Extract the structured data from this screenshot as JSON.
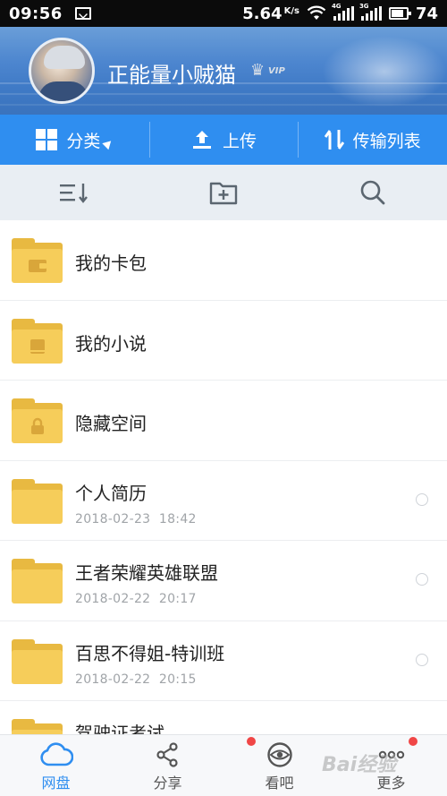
{
  "status_bar": {
    "time": "09:56",
    "speed": "5.64",
    "speed_unit": "K/s",
    "signal1_tag": "4G",
    "signal2_tag": "3G",
    "battery": "74"
  },
  "profile": {
    "username": "正能量小贼猫",
    "badge": "VIP"
  },
  "actions": {
    "category_label": "分类",
    "upload_label": "上传",
    "transfer_label": "传输列表"
  },
  "toolbar": {
    "sort_icon": "sort-icon",
    "new_folder_icon": "new-folder-icon",
    "search_icon": "search-icon"
  },
  "files": [
    {
      "name": "我的卡包",
      "date": "",
      "time": "",
      "icon": "wallet-icon"
    },
    {
      "name": "我的小说",
      "date": "",
      "time": "",
      "icon": "book-icon"
    },
    {
      "name": "隐藏空间",
      "date": "",
      "time": "",
      "icon": "lock-icon"
    },
    {
      "name": "个人简历",
      "date": "2018-02-23",
      "time": "18:42",
      "icon": ""
    },
    {
      "name": "王者荣耀英雄联盟",
      "date": "2018-02-22",
      "time": "20:17",
      "icon": ""
    },
    {
      "name": "百思不得姐-特训班",
      "date": "2018-02-22",
      "time": "20:15",
      "icon": ""
    },
    {
      "name": "驾驶证考试",
      "date": "",
      "time": "",
      "icon": ""
    }
  ],
  "bottom_nav": {
    "items": [
      {
        "label": "网盘",
        "active": true,
        "badge": false
      },
      {
        "label": "分享",
        "active": false,
        "badge": false
      },
      {
        "label": "看吧",
        "active": false,
        "badge": true
      },
      {
        "label": "更多",
        "active": false,
        "badge": true
      }
    ]
  },
  "watermark": "Bai经验",
  "colors": {
    "accent": "#2f8ef0",
    "folder": "#f6cd5a",
    "badge": "#f04646"
  }
}
